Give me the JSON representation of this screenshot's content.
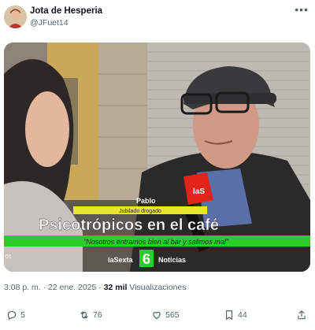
{
  "tweet": {
    "author_name": "Jota de Hesperia",
    "author_handle": "@JFuet14",
    "more_label": "•••"
  },
  "media": {
    "lower_third_name": "Pablo",
    "lower_third_role": "Jubilado drogado",
    "headline": "Psicotrópicos en el café",
    "quote": "\"Nosotros entramos bien al bar y salimos mal\"",
    "corner_number": "01",
    "channel_name": "laSexta",
    "channel_number": "6",
    "channel_section": "Noticias",
    "mic_label": "laS"
  },
  "meta": {
    "time": "3:08 p. m.",
    "separator": "·",
    "date": "22 ene. 2025",
    "views_count": "32 mil",
    "views_label": "Visualizaciones"
  },
  "actions": {
    "replies": "5",
    "reposts": "76",
    "likes": "565",
    "bookmarks": "44"
  }
}
